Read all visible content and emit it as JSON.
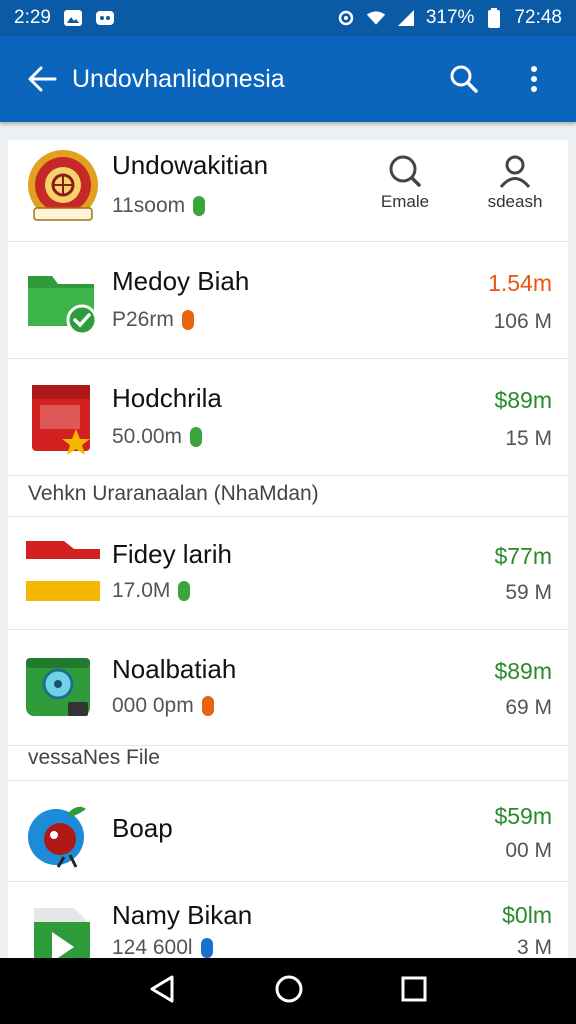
{
  "status_bar": {
    "time_left": "2:29",
    "battery": "317%",
    "time_right": "72:48"
  },
  "app_bar": {
    "title": "Undovhanlidonesia"
  },
  "header": {
    "name": "Undowakitian",
    "sub": "11soom",
    "action_1_label": "Emale",
    "action_2_label": "sdeash"
  },
  "rows": [
    {
      "name": "Medoy Biah",
      "sub": "P26rm",
      "price": "1.54m",
      "size": "106 M",
      "price_color": "#e8560f",
      "pill_color": "#e8650f"
    },
    {
      "name": "Hodchrila",
      "sub": "50.00m",
      "price": "$89m",
      "size": "15 M",
      "price_color": "#2a8a2a",
      "pill_color": "#3aa53a"
    },
    {
      "name": "Fidey larih",
      "sub": "17.0M",
      "price": "$77m",
      "size": "59 M",
      "price_color": "#2a8a2a",
      "pill_color": "#3aa53a"
    },
    {
      "name": "Noalbatiah",
      "sub": "000 0pm",
      "price": "$89m",
      "size": "69 M",
      "price_color": "#2a8a2a",
      "pill_color": "#e8650f"
    },
    {
      "name": "Boap",
      "sub": "",
      "price": "$59m",
      "size": "00 M",
      "price_color": "#2a8a2a",
      "pill_color": ""
    },
    {
      "name": "Namy Bikan",
      "sub": "124 600l",
      "price": "$0lm",
      "size": "3 M",
      "price_color": "#2a8a2a",
      "pill_color": "#1a6fd0"
    }
  ],
  "sections": {
    "s1": "Vehkn Uraranaalan (NhaMdan)",
    "s2": "vessaNes File"
  }
}
